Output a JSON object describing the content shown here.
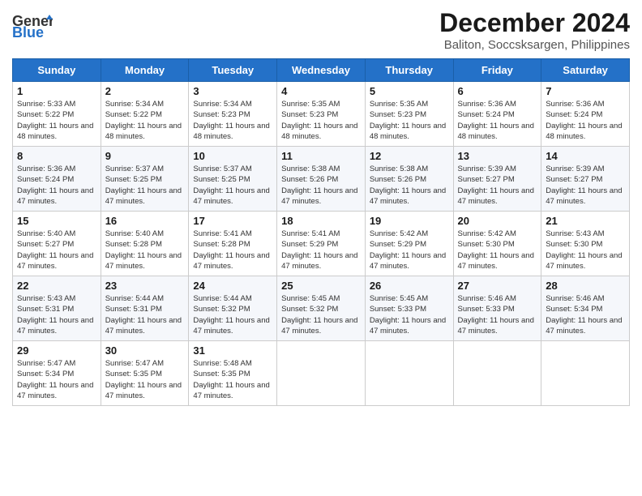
{
  "header": {
    "logo_general": "General",
    "logo_blue": "Blue",
    "title": "December 2024",
    "subtitle": "Baliton, Soccsksargen, Philippines"
  },
  "weekdays": [
    "Sunday",
    "Monday",
    "Tuesday",
    "Wednesday",
    "Thursday",
    "Friday",
    "Saturday"
  ],
  "weeks": [
    [
      {
        "day": "1",
        "sunrise": "5:33 AM",
        "sunset": "5:22 PM",
        "daylight": "11 hours and 48 minutes."
      },
      {
        "day": "2",
        "sunrise": "5:34 AM",
        "sunset": "5:22 PM",
        "daylight": "11 hours and 48 minutes."
      },
      {
        "day": "3",
        "sunrise": "5:34 AM",
        "sunset": "5:23 PM",
        "daylight": "11 hours and 48 minutes."
      },
      {
        "day": "4",
        "sunrise": "5:35 AM",
        "sunset": "5:23 PM",
        "daylight": "11 hours and 48 minutes."
      },
      {
        "day": "5",
        "sunrise": "5:35 AM",
        "sunset": "5:23 PM",
        "daylight": "11 hours and 48 minutes."
      },
      {
        "day": "6",
        "sunrise": "5:36 AM",
        "sunset": "5:24 PM",
        "daylight": "11 hours and 48 minutes."
      },
      {
        "day": "7",
        "sunrise": "5:36 AM",
        "sunset": "5:24 PM",
        "daylight": "11 hours and 48 minutes."
      }
    ],
    [
      {
        "day": "8",
        "sunrise": "5:36 AM",
        "sunset": "5:24 PM",
        "daylight": "11 hours and 47 minutes."
      },
      {
        "day": "9",
        "sunrise": "5:37 AM",
        "sunset": "5:25 PM",
        "daylight": "11 hours and 47 minutes."
      },
      {
        "day": "10",
        "sunrise": "5:37 AM",
        "sunset": "5:25 PM",
        "daylight": "11 hours and 47 minutes."
      },
      {
        "day": "11",
        "sunrise": "5:38 AM",
        "sunset": "5:26 PM",
        "daylight": "11 hours and 47 minutes."
      },
      {
        "day": "12",
        "sunrise": "5:38 AM",
        "sunset": "5:26 PM",
        "daylight": "11 hours and 47 minutes."
      },
      {
        "day": "13",
        "sunrise": "5:39 AM",
        "sunset": "5:27 PM",
        "daylight": "11 hours and 47 minutes."
      },
      {
        "day": "14",
        "sunrise": "5:39 AM",
        "sunset": "5:27 PM",
        "daylight": "11 hours and 47 minutes."
      }
    ],
    [
      {
        "day": "15",
        "sunrise": "5:40 AM",
        "sunset": "5:27 PM",
        "daylight": "11 hours and 47 minutes."
      },
      {
        "day": "16",
        "sunrise": "5:40 AM",
        "sunset": "5:28 PM",
        "daylight": "11 hours and 47 minutes."
      },
      {
        "day": "17",
        "sunrise": "5:41 AM",
        "sunset": "5:28 PM",
        "daylight": "11 hours and 47 minutes."
      },
      {
        "day": "18",
        "sunrise": "5:41 AM",
        "sunset": "5:29 PM",
        "daylight": "11 hours and 47 minutes."
      },
      {
        "day": "19",
        "sunrise": "5:42 AM",
        "sunset": "5:29 PM",
        "daylight": "11 hours and 47 minutes."
      },
      {
        "day": "20",
        "sunrise": "5:42 AM",
        "sunset": "5:30 PM",
        "daylight": "11 hours and 47 minutes."
      },
      {
        "day": "21",
        "sunrise": "5:43 AM",
        "sunset": "5:30 PM",
        "daylight": "11 hours and 47 minutes."
      }
    ],
    [
      {
        "day": "22",
        "sunrise": "5:43 AM",
        "sunset": "5:31 PM",
        "daylight": "11 hours and 47 minutes."
      },
      {
        "day": "23",
        "sunrise": "5:44 AM",
        "sunset": "5:31 PM",
        "daylight": "11 hours and 47 minutes."
      },
      {
        "day": "24",
        "sunrise": "5:44 AM",
        "sunset": "5:32 PM",
        "daylight": "11 hours and 47 minutes."
      },
      {
        "day": "25",
        "sunrise": "5:45 AM",
        "sunset": "5:32 PM",
        "daylight": "11 hours and 47 minutes."
      },
      {
        "day": "26",
        "sunrise": "5:45 AM",
        "sunset": "5:33 PM",
        "daylight": "11 hours and 47 minutes."
      },
      {
        "day": "27",
        "sunrise": "5:46 AM",
        "sunset": "5:33 PM",
        "daylight": "11 hours and 47 minutes."
      },
      {
        "day": "28",
        "sunrise": "5:46 AM",
        "sunset": "5:34 PM",
        "daylight": "11 hours and 47 minutes."
      }
    ],
    [
      {
        "day": "29",
        "sunrise": "5:47 AM",
        "sunset": "5:34 PM",
        "daylight": "11 hours and 47 minutes."
      },
      {
        "day": "30",
        "sunrise": "5:47 AM",
        "sunset": "5:35 PM",
        "daylight": "11 hours and 47 minutes."
      },
      {
        "day": "31",
        "sunrise": "5:48 AM",
        "sunset": "5:35 PM",
        "daylight": "11 hours and 47 minutes."
      },
      null,
      null,
      null,
      null
    ]
  ]
}
